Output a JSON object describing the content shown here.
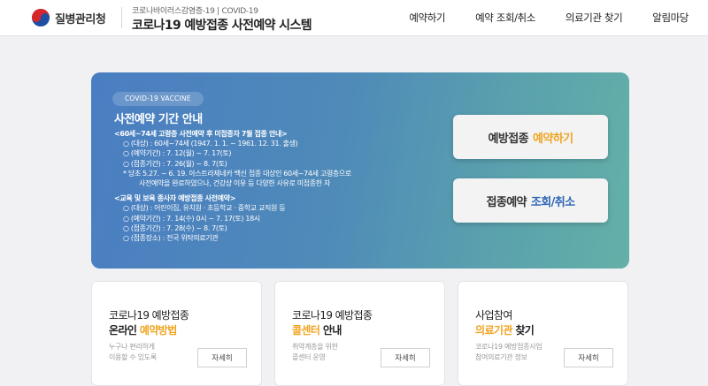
{
  "header": {
    "logo_text": "질병관리청",
    "subtitle": "코로나바이러스감염증-19 | COVID-19",
    "title": "코로나19 예방접종 사전예약 시스템",
    "nav": [
      "예약하기",
      "예약 조회/취소",
      "의료기관 찾기",
      "알림마당"
    ]
  },
  "banner": {
    "badge": "COVID-19 VACCINE",
    "title": "사전예약 기간 안내",
    "lines": [
      "<60세~74세 고령층 사전예약 후 미접종자 7월 접종 안내>",
      "○ (대상) : 60세~74세 (1947. 1. 1. ~ 1961. 12. 31. 출생)",
      "○ (예약기간) : 7. 12(월) ~ 7. 17(토)",
      "○ (접종기간) : 7. 26(월) ~ 8. 7(토)",
      "* 당초 5.27. ~ 6. 19. 아스트라제네카 백신 접종 대상인 60세~74세 고령층으로",
      "사전예약을 완료하였으나, 건강상 이유 등 다양한 사유로 미접종한 자",
      "<교육 및 보육 종사자 예방접종 사전예약>",
      "○ (대상) : 어린이집, 유치원 · 초등학교 · 중학교 교직원 등",
      "○ (예약기간) : 7. 14(수) 0시 ~ 7. 17(토) 18시",
      "○ (접종기간) : 7. 28(수) ~ 8. 7(토)",
      "○ (접종장소) : 전국 위탁의료기관"
    ],
    "cta_reserve": {
      "label": "예방접종",
      "highlight": "예약하기"
    },
    "cta_lookup": {
      "label": "접종예약",
      "highlight": "조회/취소"
    }
  },
  "cards": [
    {
      "title1": "코로나19 예방접종",
      "title2_a": "온라인",
      "title2_b": "예약방법",
      "desc1": "누구나 편리하게",
      "desc2": "이용할 수 있도록",
      "button": "자세히"
    },
    {
      "title1": "코로나19 예방접종",
      "title2_a": "콜센터",
      "title2_b": "안내",
      "desc1": "취약계층을 위한",
      "desc2": "콜센터 운영",
      "button": "자세히"
    },
    {
      "title1": "사업참여",
      "title2_a": "의료기관",
      "title2_b": "찾기",
      "desc1": "코로나19 예방접종사업",
      "desc2": "참여의료기관 정보",
      "button": "자세히"
    }
  ],
  "colors": {
    "accent_orange": "#f0a420",
    "accent_blue": "#2b65b5",
    "banner_start": "#4a7ec2",
    "banner_end": "#64b0a8"
  }
}
